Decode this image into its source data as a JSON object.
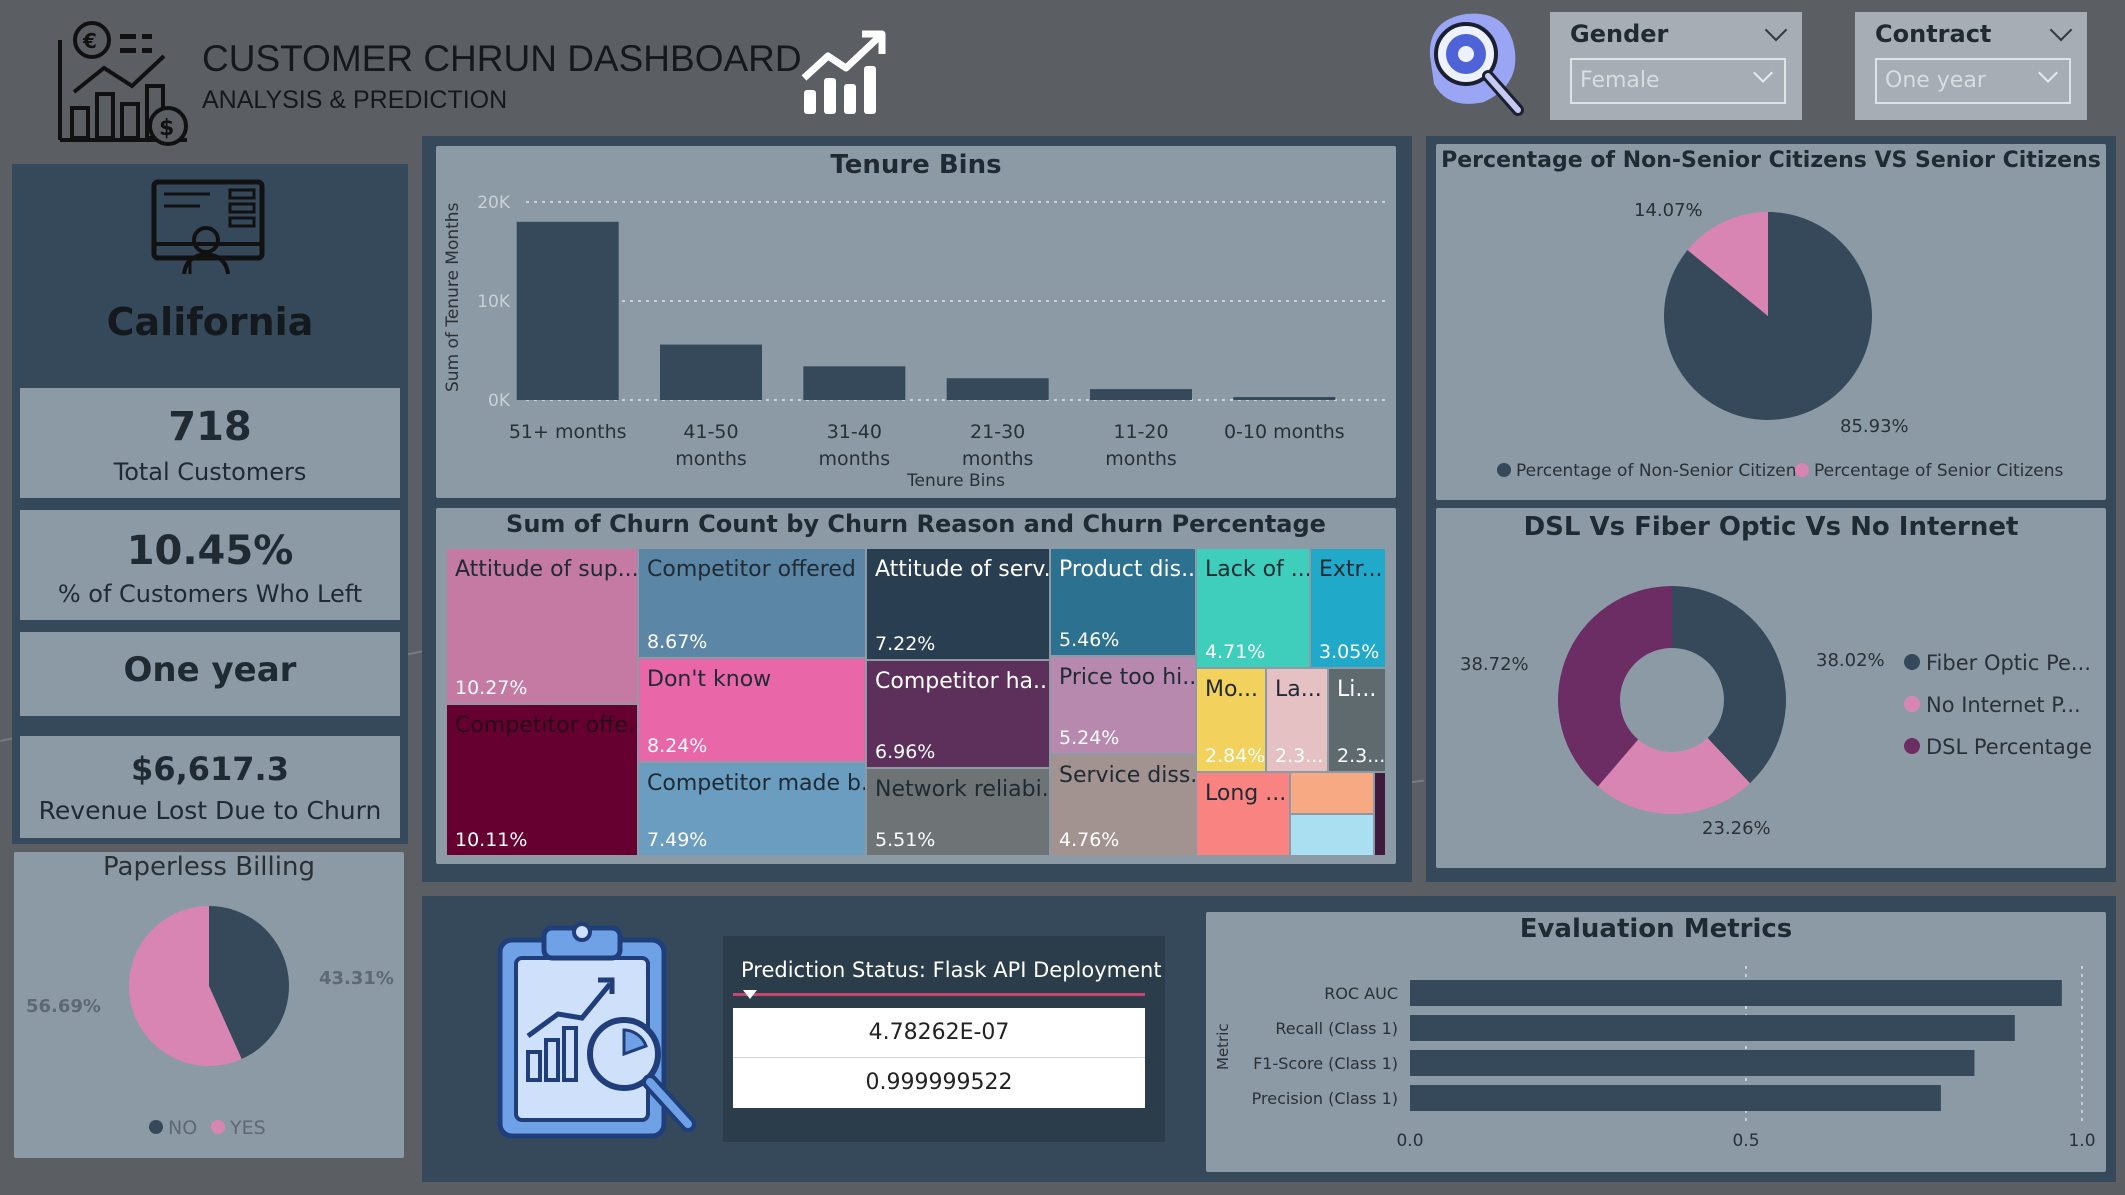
{
  "header": {
    "title": "CUSTOMER CHRUN DASHBOARD",
    "subtitle": "ANALYSIS & PREDICTION"
  },
  "filters": {
    "gender": {
      "label": "Gender",
      "value": "Female"
    },
    "contract": {
      "label": "Contract",
      "value": "One year"
    }
  },
  "kpis": {
    "state": "California",
    "total_customers": {
      "value": "718",
      "label": "Total Customers"
    },
    "pct_left": {
      "value": "10.45%",
      "label": "% of Customers Who Left"
    },
    "contract_value": "One year",
    "revenue_lost": {
      "value": "$6,617.3",
      "label": "Revenue Lost Due to Churn"
    }
  },
  "paperless": {
    "title": "Paperless Billing",
    "legend": [
      "NO",
      "YES"
    ],
    "labels": [
      "43.31%",
      "56.69%"
    ]
  },
  "tenure": {
    "title": "Tenure Bins",
    "xlabel": "Tenure Bins",
    "ylabel": "Sum of Tenure Months",
    "yticks": [
      "20K",
      "10K",
      "0K"
    ]
  },
  "treemap": {
    "title": "Sum of Churn Count by Churn Reason and Churn Percentage",
    "cells": [
      {
        "name": "Attitude of sup...",
        "pct": "10.27%"
      },
      {
        "name": "Competitor offe...",
        "pct": "10.11%"
      },
      {
        "name": "Competitor offered ...",
        "pct": "8.67%"
      },
      {
        "name": "Don't know",
        "pct": "8.24%"
      },
      {
        "name": "Competitor made b...",
        "pct": "7.49%"
      },
      {
        "name": "Attitude of serv...",
        "pct": "7.22%"
      },
      {
        "name": "Competitor ha...",
        "pct": "6.96%"
      },
      {
        "name": "Network reliabi...",
        "pct": "5.51%"
      },
      {
        "name": "Product dis...",
        "pct": "5.46%"
      },
      {
        "name": "Price too hi...",
        "pct": "5.24%"
      },
      {
        "name": "Service diss...",
        "pct": "4.76%"
      },
      {
        "name": "Lack of ...",
        "pct": "4.71%"
      },
      {
        "name": "Extr...",
        "pct": "3.05%"
      },
      {
        "name": "Mo...",
        "pct": "2.84%"
      },
      {
        "name": "La...",
        "pct": "2.3..."
      },
      {
        "name": "Li...",
        "pct": "2.3..."
      },
      {
        "name": "Long ...",
        "pct": ""
      }
    ]
  },
  "senior": {
    "title": "Percentage of Non-Senior Citizens VS Senior Citizens",
    "legend": [
      "Percentage of Non-Senior Citizens",
      "Percentage of Senior Citizens"
    ],
    "labels": [
      "14.07%",
      "85.93%"
    ]
  },
  "internet": {
    "title": "DSL Vs Fiber Optic Vs No Internet",
    "legend": [
      "Fiber Optic Pe...",
      "No Internet P...",
      "DSL Percentage"
    ],
    "labels": [
      "38.72%",
      "38.02%",
      "23.26%"
    ]
  },
  "prediction": {
    "header": "Prediction Status: Flask API Deployment",
    "rows": [
      "4.78262E-07",
      "0.999999522"
    ]
  },
  "metrics": {
    "title": "Evaluation Metrics",
    "ylabel": "Metric",
    "xticks": [
      "0.0",
      "0.5",
      "1.0"
    ]
  },
  "chart_data": [
    {
      "type": "bar",
      "title": "Tenure Bins",
      "xlabel": "Tenure Bins",
      "ylabel": "Sum of Tenure Months",
      "categories": [
        "51+ months",
        "41-50 months",
        "31-40 months",
        "21-30 months",
        "11-20 months",
        "0-10 months"
      ],
      "values": [
        18000,
        5600,
        3400,
        2200,
        1100,
        300
      ],
      "ylim": [
        0,
        20000
      ],
      "grid": true
    },
    {
      "type": "pie",
      "title": "Paperless Billing",
      "categories": [
        "NO",
        "YES"
      ],
      "values": [
        43.31,
        56.69
      ],
      "colors": [
        "#35495b",
        "#d985b3"
      ],
      "legend": "bottom"
    },
    {
      "type": "pie",
      "title": "Percentage of Non-Senior Citizens VS Senior Citizens",
      "categories": [
        "Percentage of Non-Senior Citizens",
        "Percentage of Senior Citizens"
      ],
      "values": [
        85.93,
        14.07
      ],
      "colors": [
        "#35495b",
        "#d985b3"
      ],
      "legend": "bottom"
    },
    {
      "type": "pie",
      "title": "DSL Vs Fiber Optic Vs No Internet",
      "categories": [
        "Fiber Optic Pe...",
        "No Internet P...",
        "DSL Percentage"
      ],
      "values": [
        38.02,
        23.26,
        38.72
      ],
      "colors": [
        "#35495b",
        "#d985b3",
        "#6b2d64"
      ],
      "legend": "right"
    },
    {
      "type": "bar",
      "title": "Evaluation Metrics",
      "ylabel": "Metric",
      "categories": [
        "ROC AUC",
        "Recall (Class 1)",
        "F1-Score (Class 1)",
        "Precision (Class 1)"
      ],
      "values": [
        0.97,
        0.9,
        0.84,
        0.79
      ],
      "xlim": [
        0,
        1
      ]
    }
  ]
}
